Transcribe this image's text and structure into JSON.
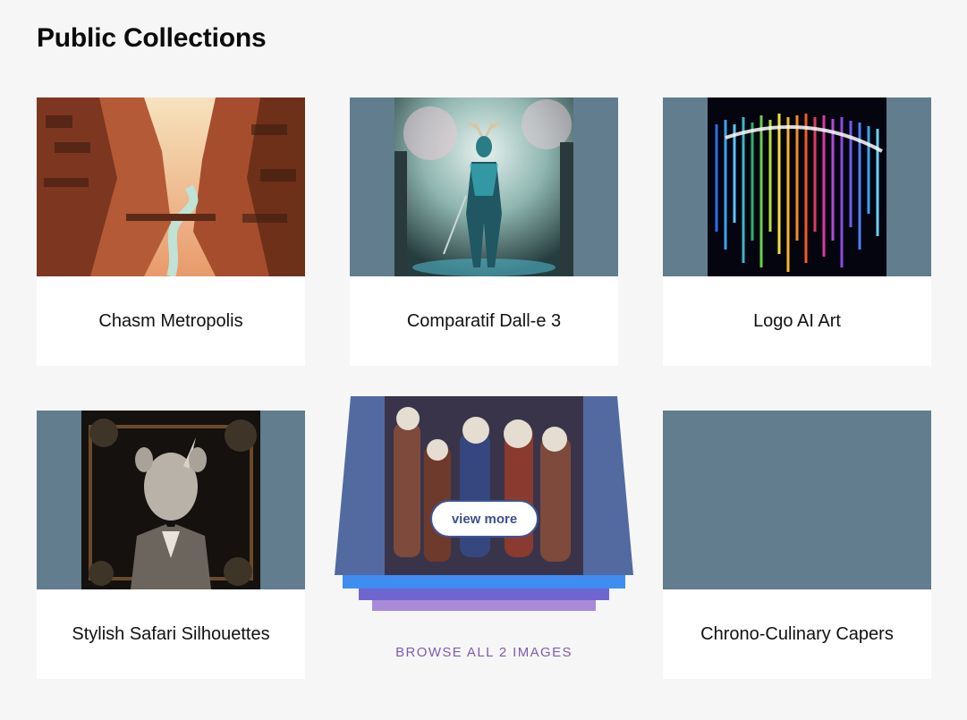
{
  "page": {
    "title": "Public Collections"
  },
  "collections": [
    {
      "name": "Chasm Metropolis"
    },
    {
      "name": "Comparatif Dall-e 3"
    },
    {
      "name": "Logo AI Art"
    },
    {
      "name": "Stylish Safari Silhouettes"
    },
    {
      "name": "",
      "view_more_label": "view more",
      "browse_label": "BROWSE ALL 2 IMAGES"
    },
    {
      "name": "Chrono-Culinary Capers"
    }
  ],
  "colors": {
    "background": "#f6f6f6",
    "thumb_fill": "#617d8e",
    "browse_text": "#7f5bb0",
    "view_more_border": "#3e5597"
  }
}
